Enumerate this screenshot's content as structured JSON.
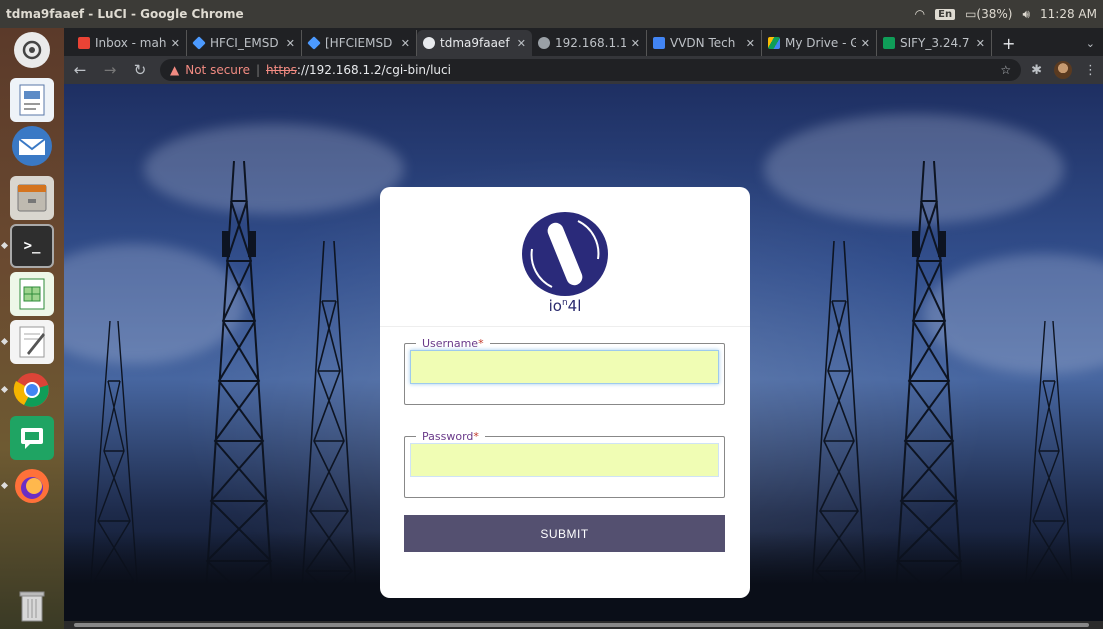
{
  "system": {
    "window_title": "tdma9faaef - LuCI - Google Chrome",
    "lang": "En",
    "battery": "(38%)",
    "clock": "11:28 AM"
  },
  "tabs": [
    {
      "label": "Inbox - mah",
      "favicon": "gmail-icon",
      "color": "#ea4335"
    },
    {
      "label": "HFCI_EMSD",
      "favicon": "jira-icon",
      "color": "#4c9aff"
    },
    {
      "label": "[HFCIEMSD",
      "favicon": "jira-icon",
      "color": "#4c9aff"
    },
    {
      "label": "tdma9faaef",
      "favicon": "globe-icon",
      "color": "#bdc1c6",
      "active": true
    },
    {
      "label": "192.168.1.1",
      "favicon": "globe-icon",
      "color": "#9aa0a6"
    },
    {
      "label": "VVDN Tech",
      "favicon": "calendar-icon",
      "color": "#4285f4"
    },
    {
      "label": "My Drive - G",
      "favicon": "drive-icon",
      "color": "#fbbc04"
    },
    {
      "label": "SIFY_3.24.7",
      "favicon": "sheets-icon",
      "color": "#0f9d58"
    }
  ],
  "address_bar": {
    "security": "Not secure",
    "scheme": "https",
    "url_rest": "://192.168.1.2/cgi-bin/luci"
  },
  "login": {
    "brand": "ionl",
    "username_label": "Username",
    "password_label": "Password",
    "required_mark": "*",
    "submit_label": "SUBMIT",
    "username_value": "",
    "password_value": ""
  },
  "colors": {
    "accent": "#545070",
    "input_bg": "#f0fdb4",
    "logo": "#2a2a7a"
  }
}
